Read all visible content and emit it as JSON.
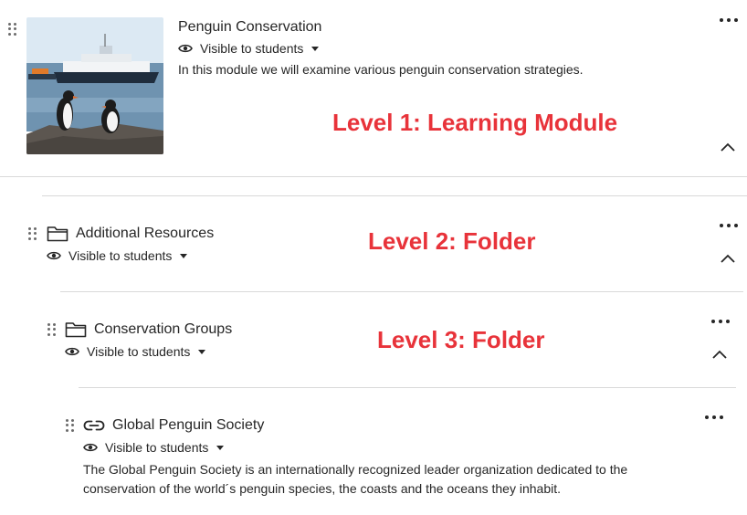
{
  "module": {
    "title": "Penguin Conservation",
    "visibility": "Visible to students",
    "description": "In this module we will examine various penguin conservation strategies."
  },
  "folder1": {
    "title": "Additional Resources",
    "visibility": "Visible to students"
  },
  "folder2": {
    "title": "Conservation Groups",
    "visibility": "Visible to students"
  },
  "link": {
    "title": "Global Penguin Society",
    "visibility": "Visible to students",
    "description_line1": "The Global Penguin Society is an internationally recognized leader organization dedicated to the",
    "description_line2": "conservation of the world´s penguin species, the coasts and the oceans they inhabit."
  },
  "annotations": {
    "level1": "Level 1: Learning Module",
    "level2": "Level 2: Folder",
    "level3": "Level 3: Folder"
  },
  "icons": {
    "drag": "drag-handle-icon",
    "visibility": "eye-icon",
    "folder": "folder-icon",
    "link": "link-icon",
    "more": "more-options-icon",
    "collapse": "chevron-up-icon"
  },
  "colors": {
    "annotation": "#e8333a",
    "text": "#262626",
    "divider": "#d9d9d9"
  }
}
